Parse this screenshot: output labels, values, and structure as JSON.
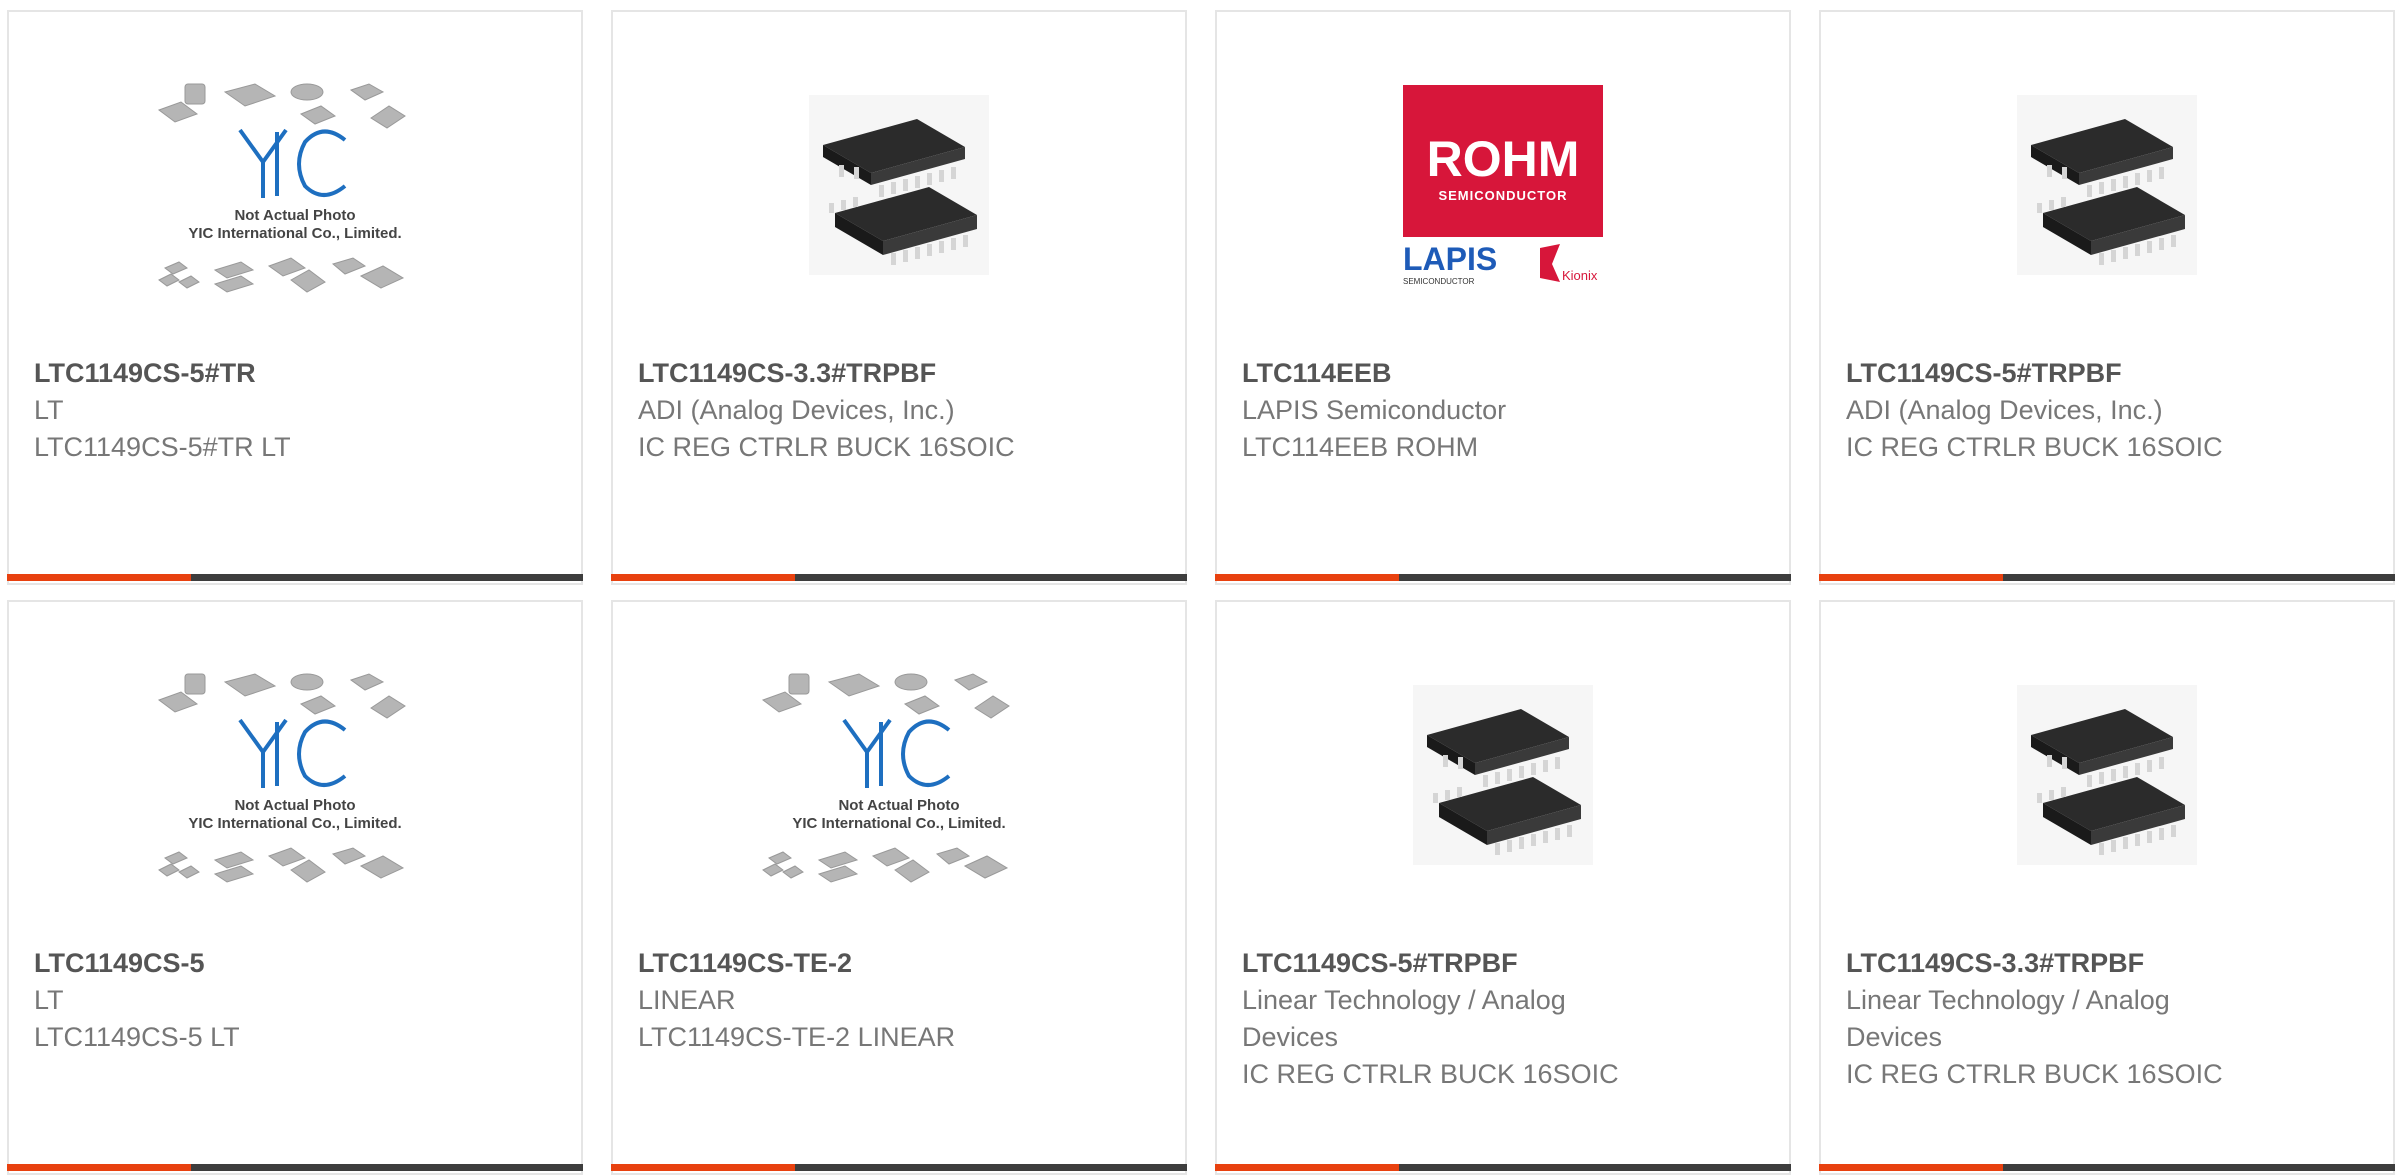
{
  "products": [
    {
      "part_number": "LTC1149CS-5#TR",
      "manufacturer": "LT",
      "description": "LTC1149CS-5#TR LT",
      "image": "yic-placeholder",
      "image_text": [
        "Not Actual Photo",
        "YIC International Co., Limited."
      ]
    },
    {
      "part_number": "LTC1149CS-3.3#TRPBF",
      "manufacturer": "ADI (Analog Devices, Inc.)",
      "description": "IC REG CTRLR BUCK 16SOIC",
      "image": "soic-chip"
    },
    {
      "part_number": "LTC114EEB",
      "manufacturer": "LAPIS Semiconductor",
      "description": "LTC114EEB ROHM",
      "image": "rohm-logo",
      "image_text": [
        "ROHM",
        "SEMICONDUCTOR",
        "LAPIS",
        "SEMICONDUCTOR",
        "Kionix"
      ]
    },
    {
      "part_number": "LTC1149CS-5#TRPBF",
      "manufacturer": "ADI (Analog Devices, Inc.)",
      "description": "IC REG CTRLR BUCK 16SOIC",
      "image": "soic-chip"
    },
    {
      "part_number": "LTC1149CS-5",
      "manufacturer": "LT",
      "description": "LTC1149CS-5 LT",
      "image": "yic-placeholder",
      "image_text": [
        "Not Actual Photo",
        "YIC International Co., Limited."
      ]
    },
    {
      "part_number": "LTC1149CS-TE-2",
      "manufacturer": "LINEAR",
      "description": "LTC1149CS-TE-2 LINEAR",
      "image": "yic-placeholder",
      "image_text": [
        "Not Actual Photo",
        "YIC International Co., Limited."
      ]
    },
    {
      "part_number": "LTC1149CS-5#TRPBF",
      "manufacturer": "Linear Technology / Analog Devices",
      "description": "IC REG CTRLR BUCK 16SOIC",
      "image": "soic-chip"
    },
    {
      "part_number": "LTC1149CS-3.3#TRPBF",
      "manufacturer": "Linear Technology / Analog Devices",
      "description": "IC REG CTRLR BUCK 16SOIC",
      "image": "soic-chip"
    }
  ],
  "colors": {
    "accent": "#e8410f",
    "bar": "#3d3d3d",
    "border": "#e5e5e5",
    "title": "#555555",
    "text": "#777777",
    "rohm_red": "#d7163a",
    "yic_blue": "#1e6fc0"
  }
}
